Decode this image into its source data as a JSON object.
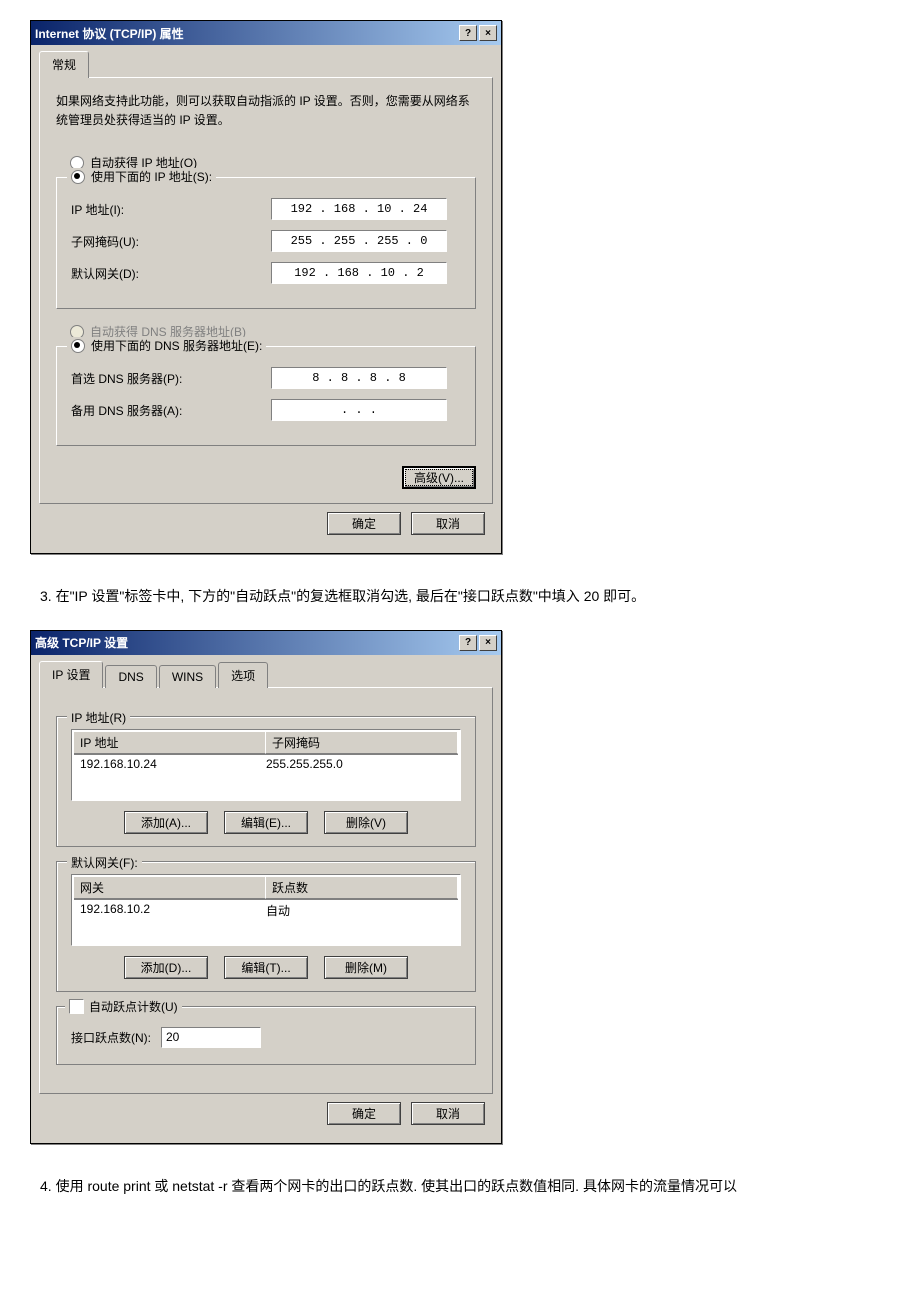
{
  "dialog1": {
    "title": "Internet 协议 (TCP/IP) 属性",
    "help_symbol": "?",
    "close_symbol": "×",
    "tab_general": "常规",
    "desc": "如果网络支持此功能，则可以获取自动指派的 IP 设置。否则，您需要从网络系统管理员处获得适当的 IP 设置。",
    "radio_auto_ip": "自动获得 IP 地址(O)",
    "radio_manual_ip": "使用下面的 IP 地址(S):",
    "ip_label": "IP 地址(I):",
    "ip_value": "192 . 168 . 10 . 24",
    "mask_label": "子网掩码(U):",
    "mask_value": "255 . 255 . 255 . 0",
    "gw_label": "默认网关(D):",
    "gw_value": "192 . 168 . 10 . 2",
    "radio_auto_dns": "自动获得 DNS 服务器地址(B)",
    "radio_manual_dns": "使用下面的 DNS 服务器地址(E):",
    "dns1_label": "首选 DNS 服务器(P):",
    "dns1_value": "8  .  8  .  8  .  8",
    "dns2_label": "备用 DNS 服务器(A):",
    "dns2_value": ".     .     .",
    "advanced_btn": "高级(V)...",
    "ok_btn": "确定",
    "cancel_btn": "取消"
  },
  "instruction3": "3. 在\"IP 设置\"标签卡中, 下方的\"自动跃点\"的复选框取消勾选, 最后在\"接口跃点数\"中填入 20 即可。",
  "dialog2": {
    "title": "高级 TCP/IP 设置",
    "help_symbol": "?",
    "close_symbol": "×",
    "tabs": [
      "IP 设置",
      "DNS",
      "WINS",
      "选项"
    ],
    "ip_group_label": "IP 地址(R)",
    "ip_col1": "IP 地址",
    "ip_col2": "子网掩码",
    "ip_row_ip": "192.168.10.24",
    "ip_row_mask": "255.255.255.0",
    "add_a": "添加(A)...",
    "edit_e": "编辑(E)...",
    "del_v": "删除(V)",
    "gw_group_label": "默认网关(F):",
    "gw_col1": "网关",
    "gw_col2": "跃点数",
    "gw_row_ip": "192.168.10.2",
    "gw_row_metric": "自动",
    "add_d": "添加(D)...",
    "edit_t": "编辑(T)...",
    "del_m": "删除(M)",
    "auto_metric_label": "自动跃点计数(U)",
    "iface_metric_label": "接口跃点数(N):",
    "iface_metric_value": "20",
    "ok_btn": "确定",
    "cancel_btn": "取消"
  },
  "instruction4": "4. 使用 route print 或 netstat -r 查看两个网卡的出口的跃点数. 使其出口的跃点数值相同. 具体网卡的流量情况可以"
}
